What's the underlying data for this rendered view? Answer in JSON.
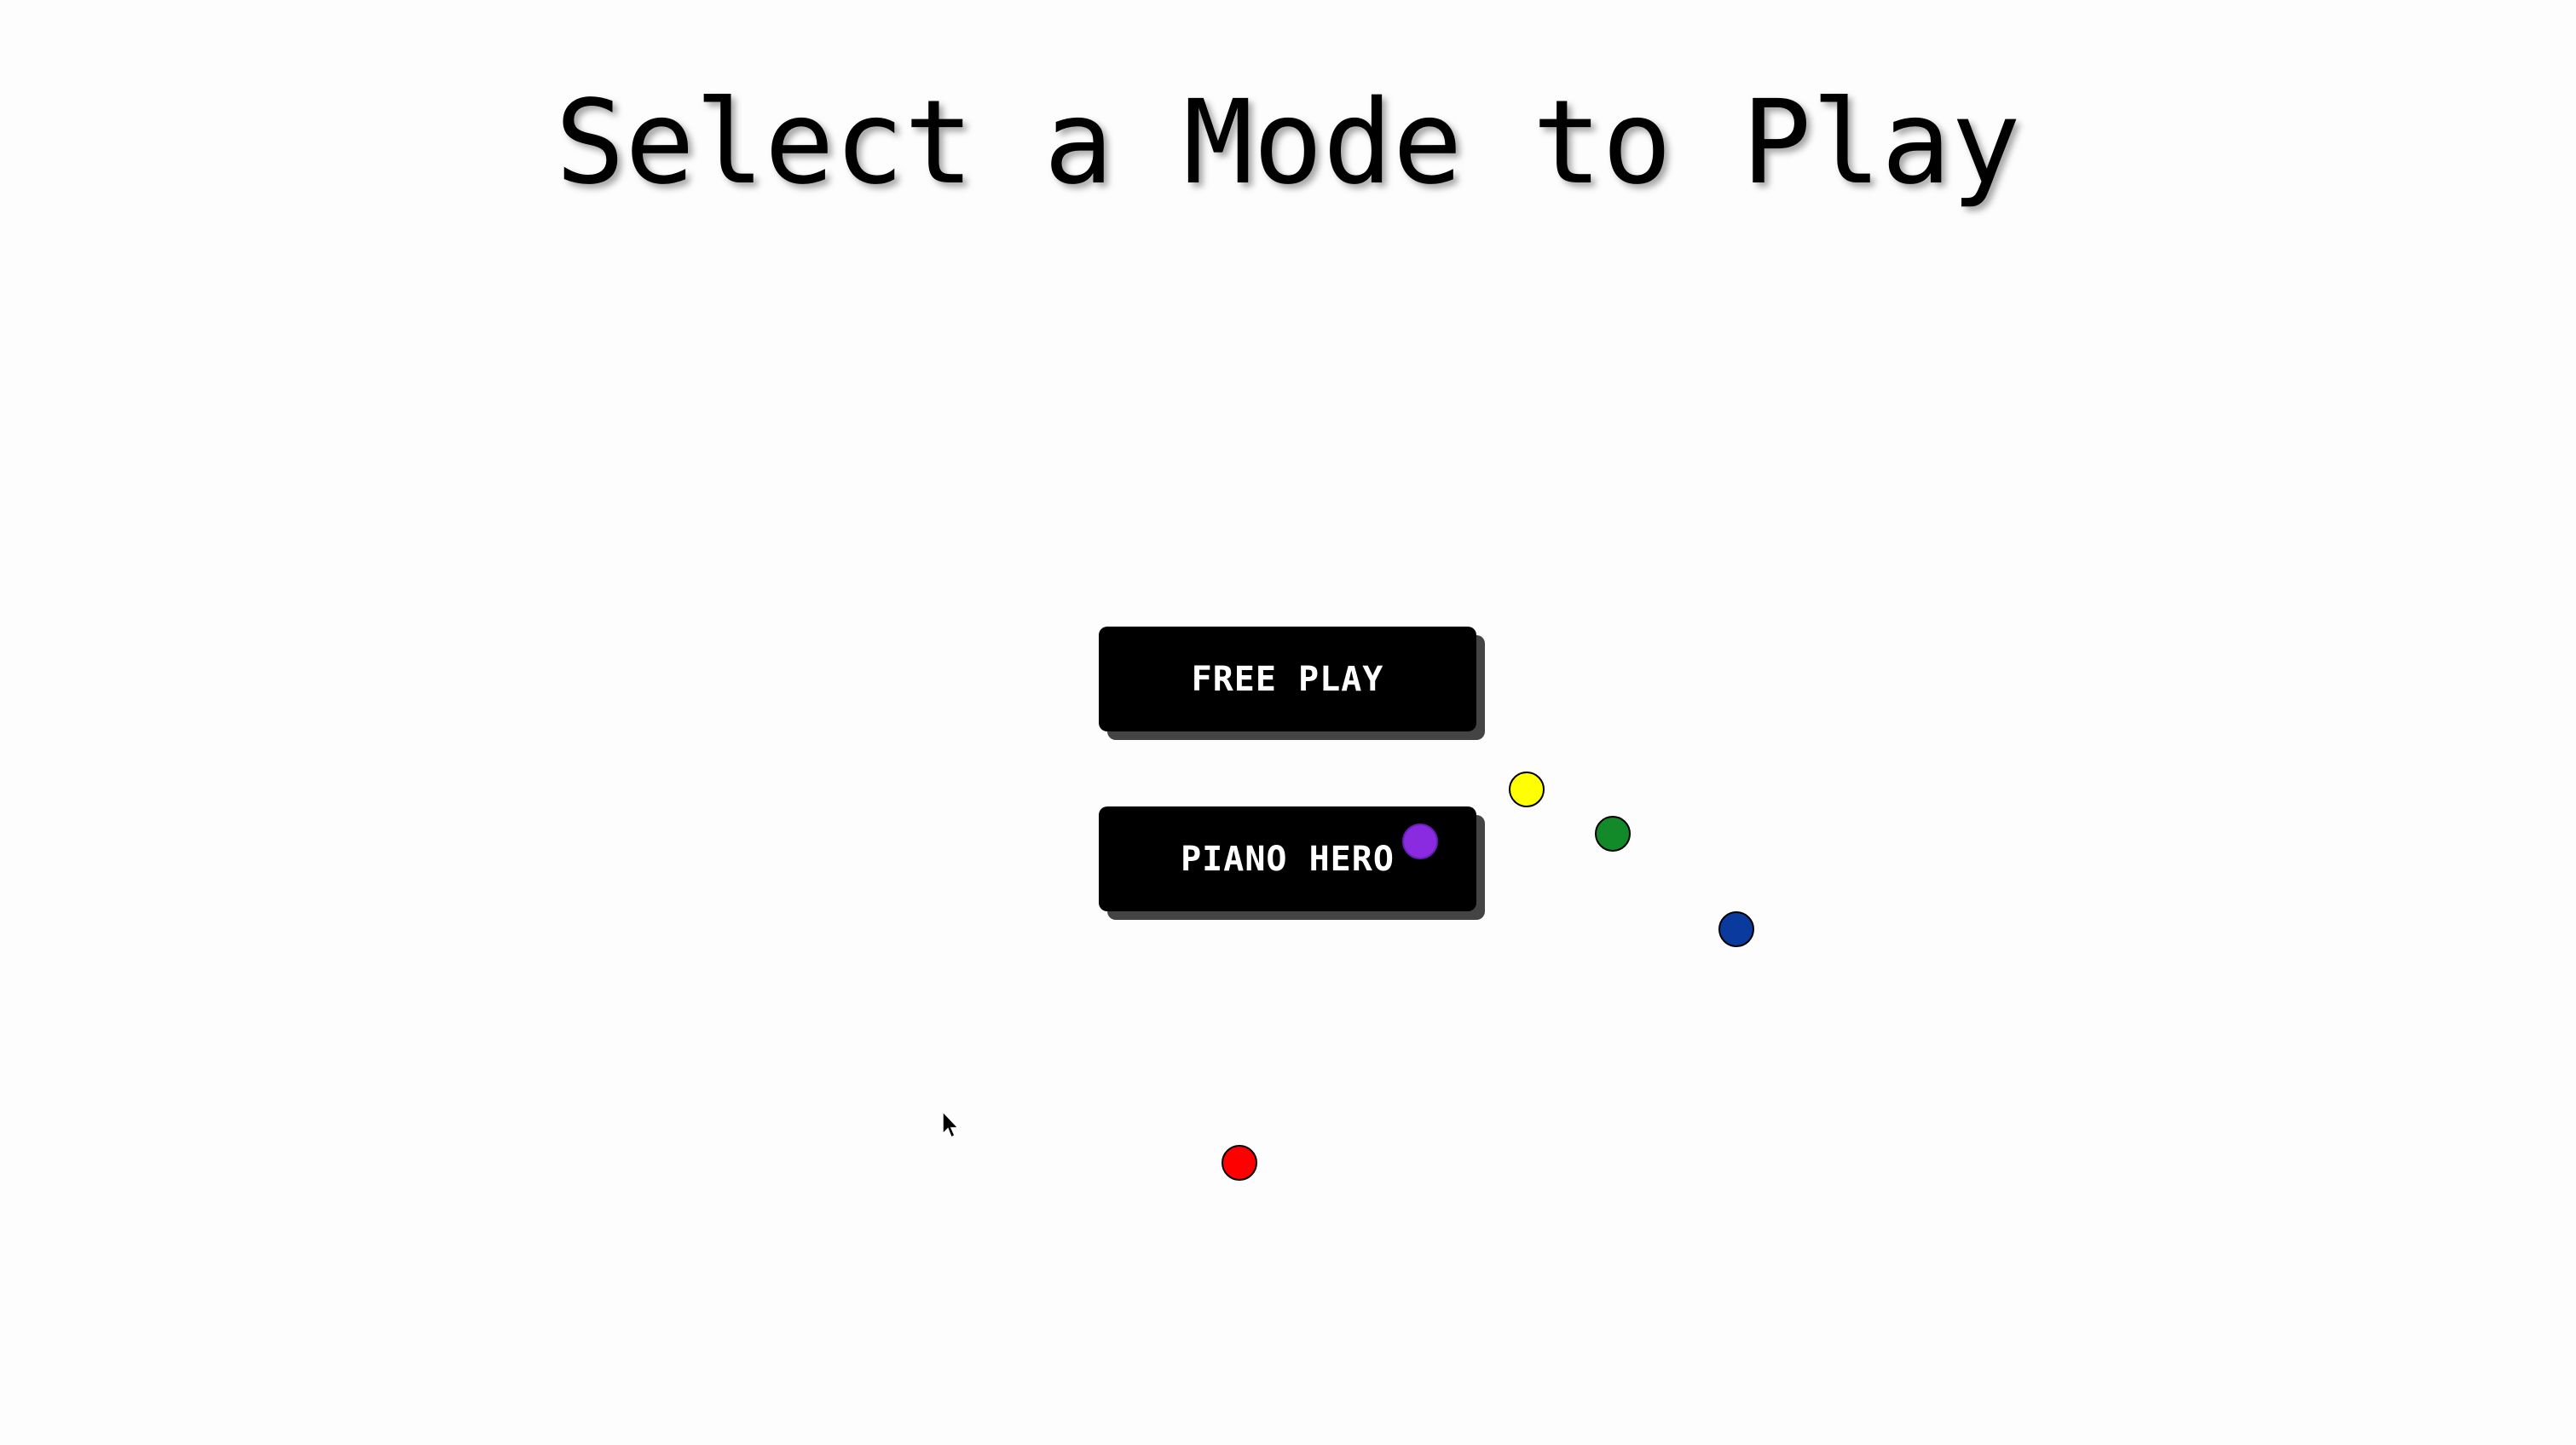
{
  "title": "Select a Mode to Play",
  "buttons": {
    "free_play": "FREE PLAY",
    "piano_hero": "PIANO HERO"
  },
  "balls": [
    {
      "name": "purple-ball",
      "color": "#8a2be2"
    },
    {
      "name": "yellow-ball",
      "color": "#ffff00"
    },
    {
      "name": "green-ball",
      "color": "#138a2a"
    },
    {
      "name": "blue-ball",
      "color": "#0a3a9e"
    },
    {
      "name": "red-ball",
      "color": "#ff0000"
    }
  ],
  "colors": {
    "background": "#fdfdfd",
    "button_bg": "#000000",
    "button_text": "#ffffff",
    "button_shadow": "#444444"
  }
}
